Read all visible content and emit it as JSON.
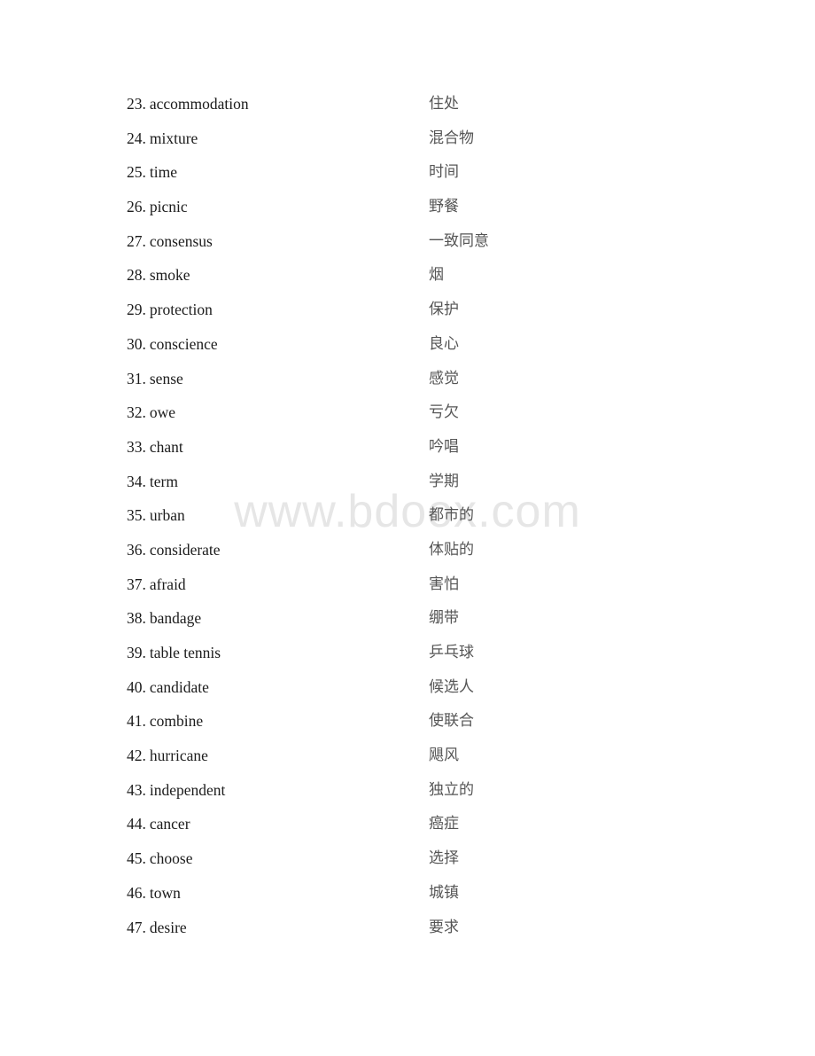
{
  "watermark": {
    "text": "www.bdoox.com"
  },
  "vocabulary": {
    "entries": [
      {
        "index": "23.",
        "term": "accommodation",
        "gloss": "住处"
      },
      {
        "index": "24.",
        "term": "mixture",
        "gloss": "混合物"
      },
      {
        "index": "25.",
        "term": "time",
        "gloss": "时间"
      },
      {
        "index": "26.",
        "term": "picnic",
        "gloss": "野餐"
      },
      {
        "index": "27.",
        "term": "consensus",
        "gloss": "一致同意"
      },
      {
        "index": "28.",
        "term": "smoke",
        "gloss": "烟"
      },
      {
        "index": "29.",
        "term": "protection",
        "gloss": "保护"
      },
      {
        "index": "30.",
        "term": "conscience",
        "gloss": "良心"
      },
      {
        "index": "31.",
        "term": "sense",
        "gloss": "感觉"
      },
      {
        "index": "32.",
        "term": "owe",
        "gloss": "亏欠"
      },
      {
        "index": "33.",
        "term": "chant",
        "gloss": "吟唱"
      },
      {
        "index": "34.",
        "term": "term",
        "gloss": "学期"
      },
      {
        "index": "35.",
        "term": "urban",
        "gloss": "都市的"
      },
      {
        "index": "36.",
        "term": "considerate",
        "gloss": "体贴的"
      },
      {
        "index": "37.",
        "term": "afraid",
        "gloss": "害怕"
      },
      {
        "index": "38.",
        "term": "bandage",
        "gloss": "绷带"
      },
      {
        "index": "39.",
        "term": "table tennis",
        "gloss": "乒乓球"
      },
      {
        "index": "40.",
        "term": "candidate",
        "gloss": "候选人"
      },
      {
        "index": "41.",
        "term": "combine",
        "gloss": "使联合"
      },
      {
        "index": "42.",
        "term": "hurricane",
        "gloss": "飓风"
      },
      {
        "index": "43.",
        "term": "independent",
        "gloss": "独立的"
      },
      {
        "index": "44.",
        "term": "cancer",
        "gloss": "癌症"
      },
      {
        "index": "45.",
        "term": "choose",
        "gloss": "选择"
      },
      {
        "index": "46.",
        "term": "town",
        "gloss": "城镇"
      },
      {
        "index": "47.",
        "term": "desire",
        "gloss": "要求"
      }
    ]
  }
}
